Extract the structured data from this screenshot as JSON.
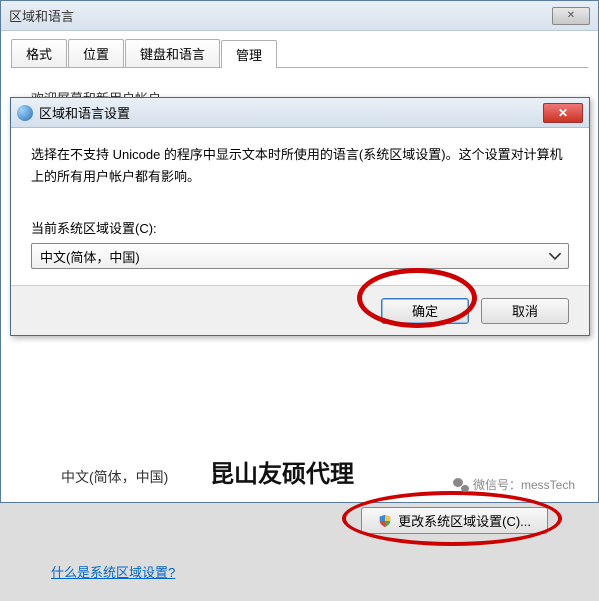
{
  "parent": {
    "title": "区域和语言",
    "tabs": [
      "格式",
      "位置",
      "键盘和语言",
      "管理"
    ],
    "activeTab": 3,
    "truncated_text": "欢迎屏幕和新用户帐户",
    "current_locale_display": "中文(简体，中国)",
    "change_button": "更改系统区域设置(C)...",
    "help_link": "什么是系统区域设置?"
  },
  "dialog": {
    "title": "区域和语言设置",
    "description": "选择在不支持 Unicode 的程序中显示文本时所使用的语言(系统区域设置)。这个设置对计算机上的所有用户帐户都有影响。",
    "field_label": "当前系统区域设置(C):",
    "combo_value": "中文(简体，中国)",
    "ok": "确定",
    "cancel": "取消"
  },
  "annotations": {
    "watermark": "昆山友硕代理",
    "wechat": "微信号：messTech"
  }
}
